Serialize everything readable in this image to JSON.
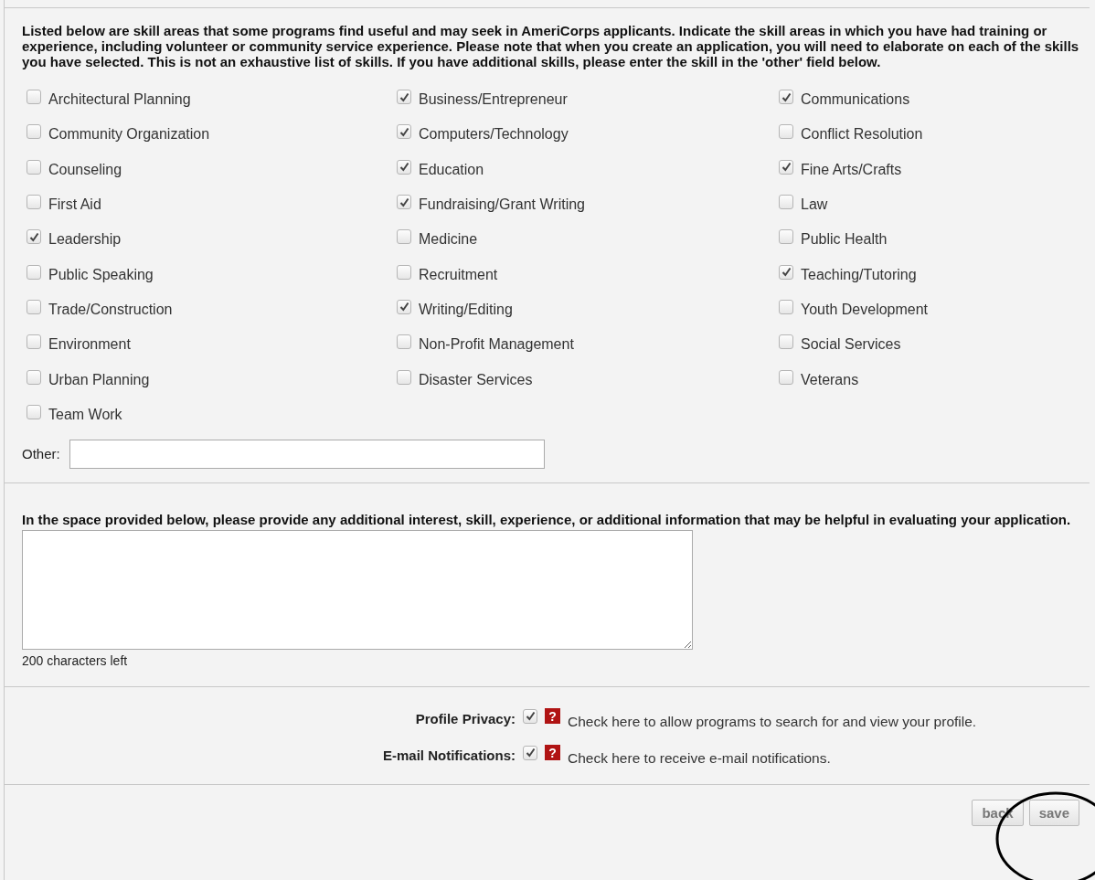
{
  "intro": "Listed below are skill areas that some programs find useful and may seek in AmeriCorps applicants. Indicate the skill areas in which you have had training or experience, including volunteer or community service experience. Please note that when you create an application, you will need to elaborate on each of the skills you have selected. This is not an exhaustive list of skills. If you have additional skills, please enter the skill in the 'other' field below.",
  "skills": [
    {
      "label": "Architectural Planning",
      "checked": false
    },
    {
      "label": "Business/Entrepreneur",
      "checked": true
    },
    {
      "label": "Communications",
      "checked": true
    },
    {
      "label": "Community Organization",
      "checked": false
    },
    {
      "label": "Computers/Technology",
      "checked": true
    },
    {
      "label": "Conflict Resolution",
      "checked": false
    },
    {
      "label": "Counseling",
      "checked": false
    },
    {
      "label": "Education",
      "checked": true
    },
    {
      "label": "Fine Arts/Crafts",
      "checked": true
    },
    {
      "label": "First Aid",
      "checked": false
    },
    {
      "label": "Fundraising/Grant Writing",
      "checked": true
    },
    {
      "label": "Law",
      "checked": false
    },
    {
      "label": "Leadership",
      "checked": true
    },
    {
      "label": "Medicine",
      "checked": false
    },
    {
      "label": "Public Health",
      "checked": false
    },
    {
      "label": "Public Speaking",
      "checked": false
    },
    {
      "label": "Recruitment",
      "checked": false
    },
    {
      "label": "Teaching/Tutoring",
      "checked": true
    },
    {
      "label": "Trade/Construction",
      "checked": false
    },
    {
      "label": "Writing/Editing",
      "checked": true
    },
    {
      "label": "Youth Development",
      "checked": false
    },
    {
      "label": "Environment",
      "checked": false
    },
    {
      "label": "Non-Profit Management",
      "checked": false
    },
    {
      "label": "Social Services",
      "checked": false
    },
    {
      "label": "Urban Planning",
      "checked": false
    },
    {
      "label": "Disaster Services",
      "checked": false
    },
    {
      "label": "Veterans",
      "checked": false
    },
    {
      "label": "Team Work",
      "checked": false
    }
  ],
  "other": {
    "label": "Other:"
  },
  "additional": {
    "prompt": "In the space provided below, please provide any additional interest, skill, experience, or additional information that may be helpful in evaluating your application.",
    "counter": "200 characters left"
  },
  "preferences": [
    {
      "label": "Profile Privacy:",
      "checked": true,
      "help_mark": "?",
      "description": "Check here to allow programs to search for and view your profile."
    },
    {
      "label": "E-mail Notifications:",
      "checked": true,
      "help_mark": "?",
      "description": "Check here to receive e-mail notifications."
    }
  ],
  "buttons": [
    "back",
    "save"
  ]
}
